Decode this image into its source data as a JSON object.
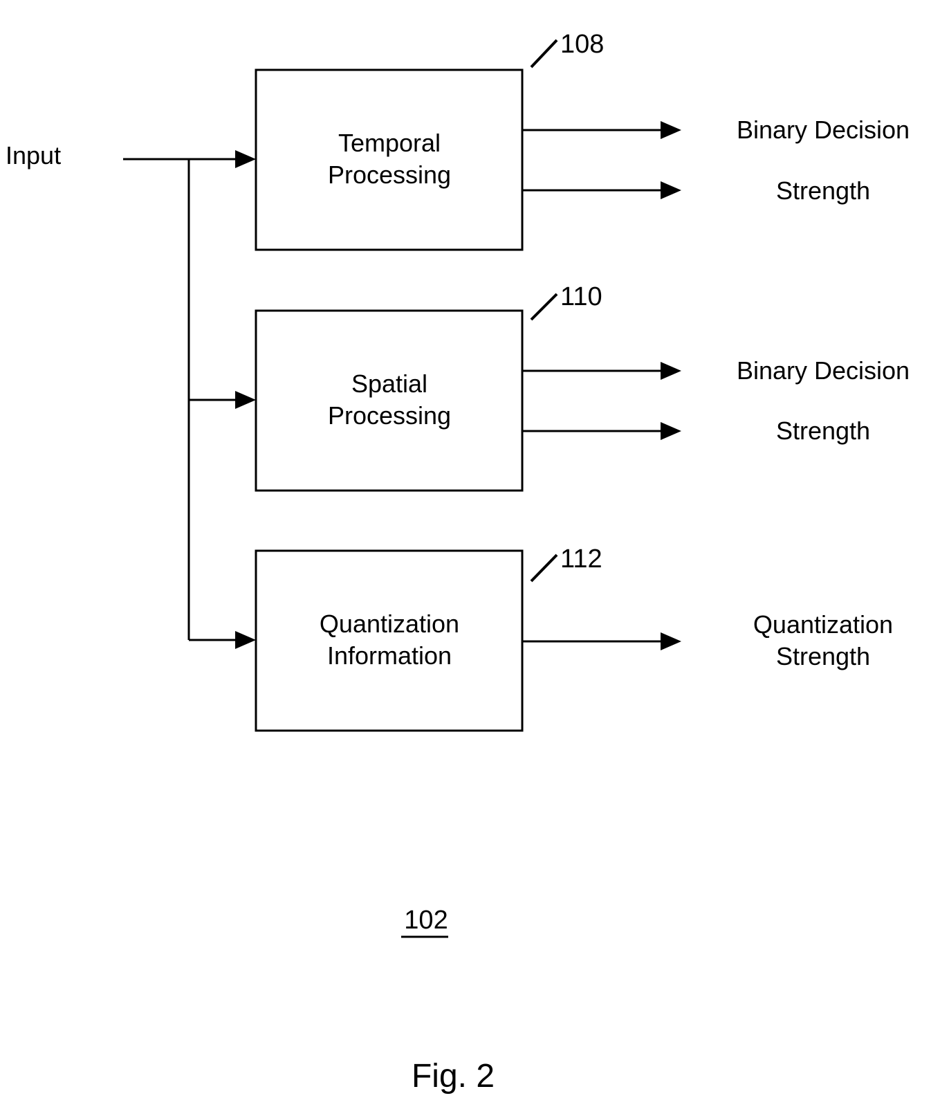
{
  "figure": {
    "caption": "Fig. 2",
    "reference": "102",
    "input_label": "Input",
    "blocks": [
      {
        "ref": "108",
        "title_line1": "Temporal",
        "title_line2": "Processing",
        "outputs": [
          "Binary Decision",
          "Strength"
        ]
      },
      {
        "ref": "110",
        "title_line1": "Spatial",
        "title_line2": "Processing",
        "outputs": [
          "Binary Decision",
          "Strength"
        ]
      },
      {
        "ref": "112",
        "title_line1": "Quantization",
        "title_line2": "Information",
        "output_line1": "Quantization",
        "output_line2": "Strength"
      }
    ]
  }
}
